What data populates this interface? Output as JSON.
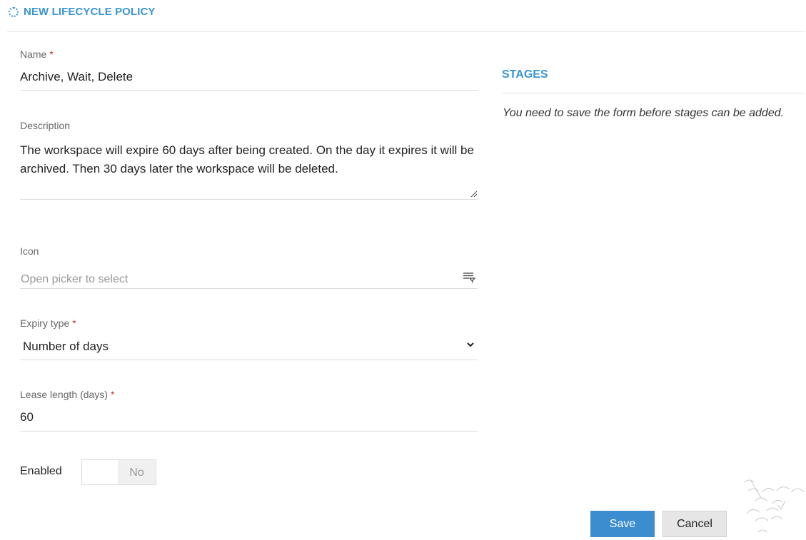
{
  "header": {
    "title": "NEW LIFECYCLE POLICY",
    "icon": "loading-spinner-icon"
  },
  "form": {
    "name": {
      "label": "Name",
      "required_marker": "*",
      "value": "Archive, Wait, Delete"
    },
    "description": {
      "label": "Description",
      "value": "The workspace will expire 60 days after being created. On the day it expires it will be archived. Then 30 days later the workspace will be deleted."
    },
    "icon": {
      "label": "Icon",
      "placeholder": "Open picker to select",
      "picker_icon": "filter-list-icon"
    },
    "expiry_type": {
      "label": "Expiry type",
      "required_marker": "*",
      "value": "Number of days",
      "options_icon": "chevron-down-icon"
    },
    "lease_length": {
      "label": "Lease length (days)",
      "required_marker": "*",
      "value": "60"
    },
    "enabled": {
      "label": "Enabled",
      "toggle_state": "No"
    }
  },
  "stages": {
    "title": "STAGES",
    "message": "You need to save the form before stages can be added."
  },
  "actions": {
    "save_label": "Save",
    "cancel_label": "Cancel"
  },
  "colors": {
    "accent": "#3b95d1",
    "save_button": "#3b8dd0",
    "required": "#c0392b"
  }
}
